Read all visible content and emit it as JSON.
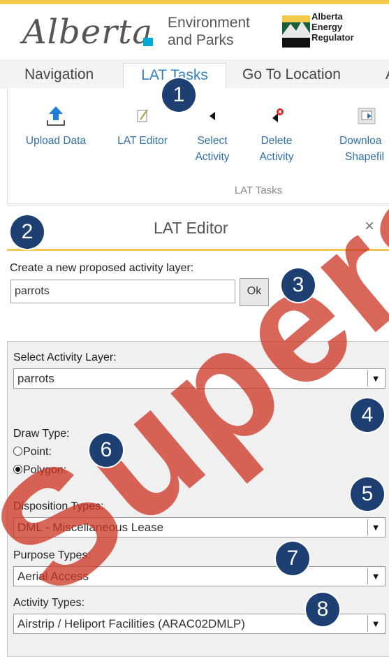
{
  "header": {
    "logo_word": "Alberta",
    "logo_subtitle_line1": "Environment",
    "logo_subtitle_line2": "and Parks",
    "aer_line1": "Alberta",
    "aer_line2": "Energy",
    "aer_line3": "Regulator"
  },
  "tabs": [
    {
      "label": "Navigation",
      "active": false
    },
    {
      "label": "LAT Tasks",
      "active": true
    },
    {
      "label": "Go To Location",
      "active": false
    },
    {
      "label": "A",
      "active": false
    }
  ],
  "ribbon": {
    "upload": "Upload Data",
    "lat_editor": "LAT Editor",
    "select_1": "Select",
    "select_2": "Activity",
    "delete_1": "Delete",
    "delete_2": "Activity",
    "download_1": "Downloa",
    "download_2": "Shapefil",
    "group_label": "LAT Tasks"
  },
  "panel": {
    "title": "LAT Editor",
    "close": "×"
  },
  "form": {
    "new_layer_label": "Create a new proposed activity layer:",
    "new_layer_value": "parrots",
    "ok_label": "Ok",
    "select_layer_label": "Select Activity Layer:",
    "select_layer_value": "parrots",
    "draw_type_label": "Draw Type:",
    "point_label": "Point:",
    "polygon_label": "Polygon:",
    "disposition_label": "Disposition Types:",
    "disposition_value": "DML - Miscellaneous Lease",
    "purpose_label": "Purpose Types:",
    "purpose_value": "Aerial Access",
    "activity_label": "Activity Types:",
    "activity_value": "Airstrip / Heliport Facilities (ARAC02DMLP)"
  },
  "callouts": [
    "1",
    "2",
    "3",
    "4",
    "5",
    "6",
    "7",
    "8"
  ],
  "watermark": "Superseded",
  "colors": {
    "accent_yellow": "#f2c94c",
    "tab_blue": "#2f7fbf",
    "callout_navy": "#1e3f72",
    "watermark_red": "#cc3322"
  }
}
